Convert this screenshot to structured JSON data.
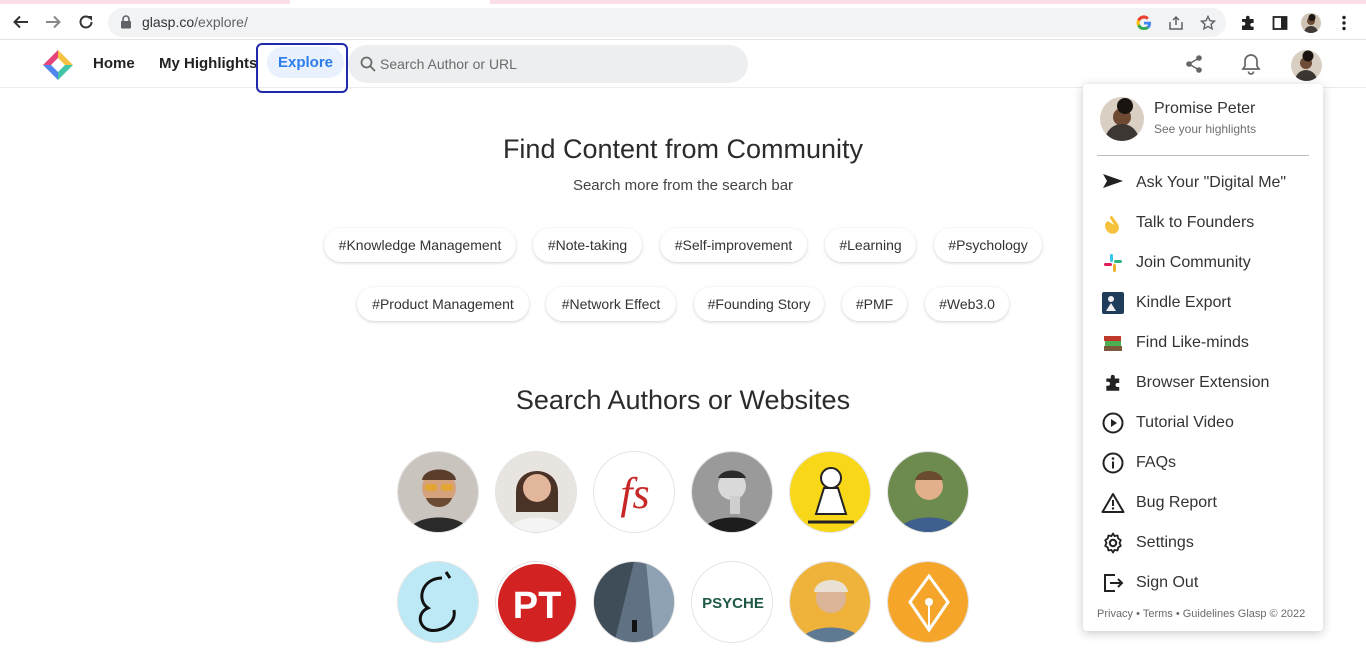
{
  "browser": {
    "url_domain": "glasp.co",
    "url_path": "/explore/"
  },
  "header": {
    "nav": {
      "home": "Home",
      "highlights": "My Highlights",
      "explore": "Explore"
    },
    "search_placeholder": "Search Author or URL"
  },
  "main": {
    "title": "Find Content from Community",
    "subtitle": "Search more from the search bar",
    "tags": [
      "#Knowledge Management",
      "#Note-taking",
      "#Self-improvement",
      "#Learning",
      "#Psychology",
      "#Product Management",
      "#Network Effect",
      "#Founding Story",
      "#PMF",
      "#Web3.0"
    ],
    "authors_title": "Search Authors or Websites",
    "author_logo_texts": [
      "fs",
      "PT",
      "PSYCHE"
    ]
  },
  "menu": {
    "profile_name": "Promise Peter",
    "profile_sub": "See your highlights",
    "items": [
      {
        "label": "Ask Your \"Digital Me\"",
        "icon": "send-icon"
      },
      {
        "label": "Talk to Founders",
        "icon": "waving-hand-icon"
      },
      {
        "label": "Join Community",
        "icon": "slack-icon"
      },
      {
        "label": "Kindle Export",
        "icon": "kindle-icon"
      },
      {
        "label": "Find Like-minds",
        "icon": "books-icon"
      },
      {
        "label": "Browser Extension",
        "icon": "puzzle-icon"
      },
      {
        "label": "Tutorial Video",
        "icon": "play-icon"
      },
      {
        "label": "FAQs",
        "icon": "info-icon"
      },
      {
        "label": "Bug Report",
        "icon": "warning-icon"
      },
      {
        "label": "Settings",
        "icon": "gear-icon"
      },
      {
        "label": "Sign Out",
        "icon": "sign-out-icon"
      }
    ],
    "footer": "Privacy • Terms • Guidelines Glasp © 2022"
  },
  "colors": {
    "accent": "#2b7de9",
    "explore_bg": "#e8f1fd",
    "annotation": "#1f2aa8"
  }
}
